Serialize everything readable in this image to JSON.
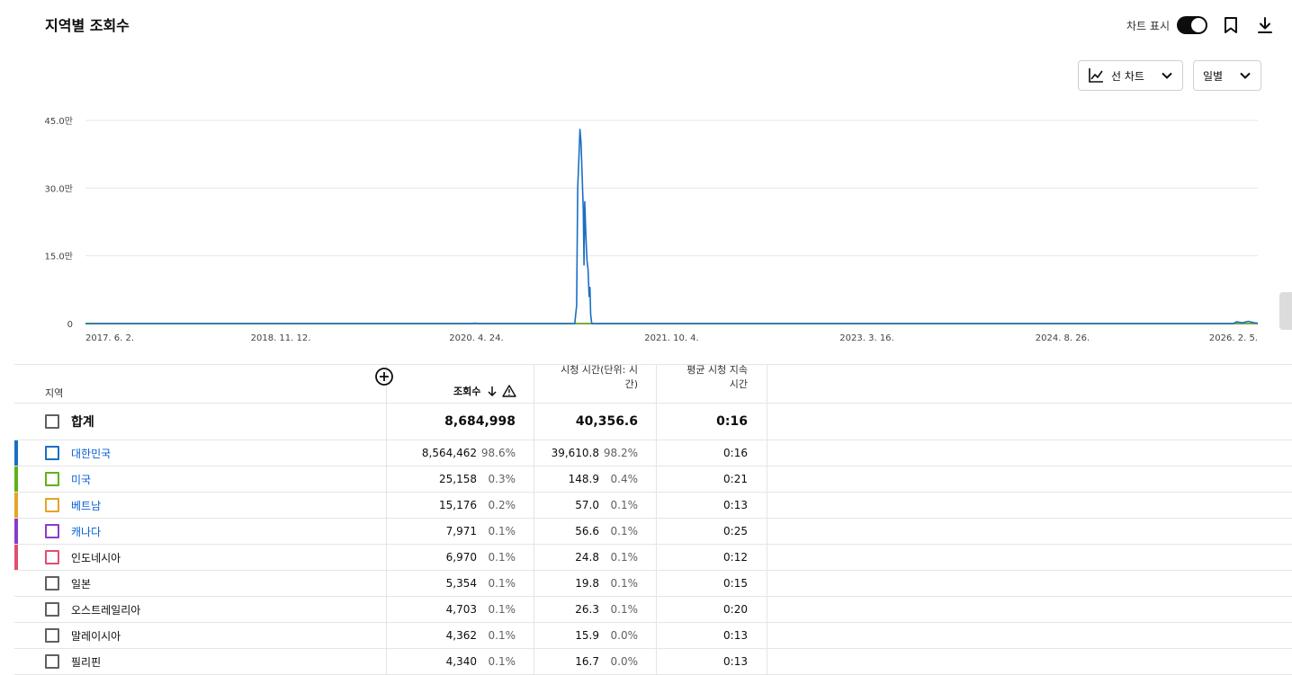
{
  "header": {
    "title": "지역별 조회수",
    "toggle_label": "차트 표시",
    "icons": [
      "bookmark-icon",
      "download-icon"
    ]
  },
  "controls": {
    "chart_type_label": "선 차트",
    "period_label": "일별"
  },
  "chart_data": {
    "type": "line",
    "y_ticks": [
      "45.0만",
      "30.0만",
      "15.0만",
      "0"
    ],
    "x_ticks": [
      "2017. 6. 2.",
      "2018. 11. 12.",
      "2020. 4. 24.",
      "2021. 10. 4.",
      "2023. 3. 16.",
      "2024. 8. 26.",
      "2026. 2. 5."
    ],
    "ylim": [
      0,
      450000
    ],
    "grid": true,
    "series": [
      {
        "name": "대한민국",
        "color": "#1a6fc4",
        "points": [
          [
            "2017-06-02",
            0
          ],
          [
            "2020-04-10",
            0
          ],
          [
            "2020-04-20",
            800
          ],
          [
            "2020-05-01",
            0
          ],
          [
            "2021-01-15",
            0
          ],
          [
            "2021-01-20",
            40000
          ],
          [
            "2021-01-23",
            300000
          ],
          [
            "2021-01-26",
            360000
          ],
          [
            "2021-01-29",
            430000
          ],
          [
            "2021-02-01",
            400000
          ],
          [
            "2021-02-04",
            330000
          ],
          [
            "2021-02-07",
            250000
          ],
          [
            "2021-02-09",
            130000
          ],
          [
            "2021-02-11",
            270000
          ],
          [
            "2021-02-14",
            200000
          ],
          [
            "2021-02-17",
            140000
          ],
          [
            "2021-02-20",
            120000
          ],
          [
            "2021-02-23",
            60000
          ],
          [
            "2021-02-25",
            80000
          ],
          [
            "2021-02-27",
            20000
          ],
          [
            "2021-03-02",
            0
          ],
          [
            "2025-12-01",
            0
          ],
          [
            "2025-12-10",
            4000
          ],
          [
            "2025-12-25",
            1500
          ],
          [
            "2026-01-10",
            5000
          ],
          [
            "2026-01-25",
            2000
          ],
          [
            "2026-02-05",
            1000
          ]
        ]
      },
      {
        "name": "미국",
        "color": "#5fb21a",
        "points": [
          [
            "2017-06-02",
            0
          ],
          [
            "2026-02-05",
            0
          ]
        ]
      },
      {
        "name": "베트남",
        "color": "#e4a428",
        "points": [
          [
            "2017-06-02",
            0
          ],
          [
            "2026-02-05",
            0
          ]
        ]
      },
      {
        "name": "캐나다",
        "color": "#8a3cc7",
        "points": [
          [
            "2017-06-02",
            0
          ],
          [
            "2026-02-05",
            0
          ]
        ]
      }
    ]
  },
  "table": {
    "headers": {
      "region": "지역",
      "views": "조회수",
      "watch_time_1": "시청 시간(단위: 시",
      "watch_time_2": "간)",
      "avg_1": "평균 시청 지속",
      "avg_2": "시간"
    },
    "total": {
      "label": "합계",
      "views": "8,684,998",
      "watch_time": "40,356.6",
      "avg": "0:16"
    },
    "rows": [
      {
        "region": "대한민국",
        "color": "#1a6fc4",
        "link": true,
        "views": "8,564,462",
        "views_pct": "98.6%",
        "watch": "39,610.8",
        "watch_pct": "98.2%",
        "avg": "0:16"
      },
      {
        "region": "미국",
        "color": "#5fb21a",
        "link": true,
        "views": "25,158",
        "views_pct": "0.3%",
        "watch": "148.9",
        "watch_pct": "0.4%",
        "avg": "0:21"
      },
      {
        "region": "베트남",
        "color": "#e4a428",
        "link": true,
        "views": "15,176",
        "views_pct": "0.2%",
        "watch": "57.0",
        "watch_pct": "0.1%",
        "avg": "0:13"
      },
      {
        "region": "캐나다",
        "color": "#8a3cc7",
        "link": true,
        "views": "7,971",
        "views_pct": "0.1%",
        "watch": "56.6",
        "watch_pct": "0.1%",
        "avg": "0:25"
      },
      {
        "region": "인도네시아",
        "color": "#e0506d",
        "link": false,
        "views": "6,970",
        "views_pct": "0.1%",
        "watch": "24.8",
        "watch_pct": "0.1%",
        "avg": "0:12"
      },
      {
        "region": "일본",
        "color": "",
        "link": false,
        "views": "5,354",
        "views_pct": "0.1%",
        "watch": "19.8",
        "watch_pct": "0.1%",
        "avg": "0:15"
      },
      {
        "region": "오스트레일리아",
        "color": "",
        "link": false,
        "views": "4,703",
        "views_pct": "0.1%",
        "watch": "26.3",
        "watch_pct": "0.1%",
        "avg": "0:20"
      },
      {
        "region": "말레이시아",
        "color": "",
        "link": false,
        "views": "4,362",
        "views_pct": "0.1%",
        "watch": "15.9",
        "watch_pct": "0.0%",
        "avg": "0:13"
      },
      {
        "region": "필리핀",
        "color": "",
        "link": false,
        "views": "4,340",
        "views_pct": "0.1%",
        "watch": "16.7",
        "watch_pct": "0.0%",
        "avg": "0:13"
      }
    ]
  }
}
